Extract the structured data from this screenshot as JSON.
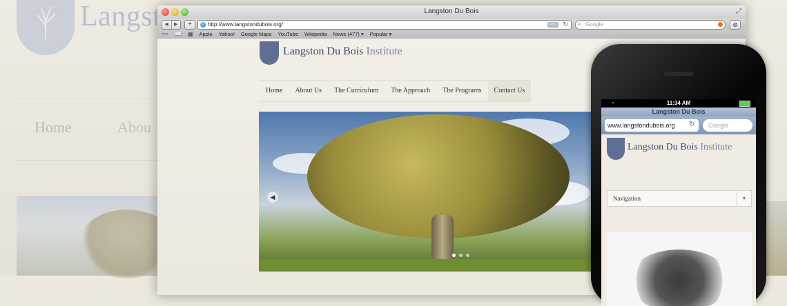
{
  "background": {
    "logo_text": "Langston Du Bois",
    "nav": {
      "home": "Home",
      "about": "Abou"
    }
  },
  "browser": {
    "window_title": "Langston Du Bois",
    "url": "http://www.langstondubois.org/",
    "search_placeholder": "Google",
    "bookmarks": [
      "Apple",
      "Yahoo!",
      "Google Maps",
      "YouTube",
      "Wikipedia",
      "News (477) ▾",
      "Popular ▾"
    ]
  },
  "site": {
    "logo_main": "Langston Du Bois",
    "logo_sub": "Institute",
    "nav": [
      "Home",
      "About Us",
      "The Curriculum",
      "The Approach",
      "The Programs",
      "Contact Us"
    ]
  },
  "phone": {
    "time": "11:34 AM",
    "page_title": "Langston Du Bois",
    "url": "www.langstondubois.org",
    "search_placeholder": "Google",
    "logo_main": "Langston Du Bois",
    "logo_sub": "Institute",
    "nav_select": "Navigation"
  },
  "colors": {
    "brand_blue": "#3c4a6e",
    "crest": "#5f6f94",
    "page_bg": "#ece8de"
  }
}
